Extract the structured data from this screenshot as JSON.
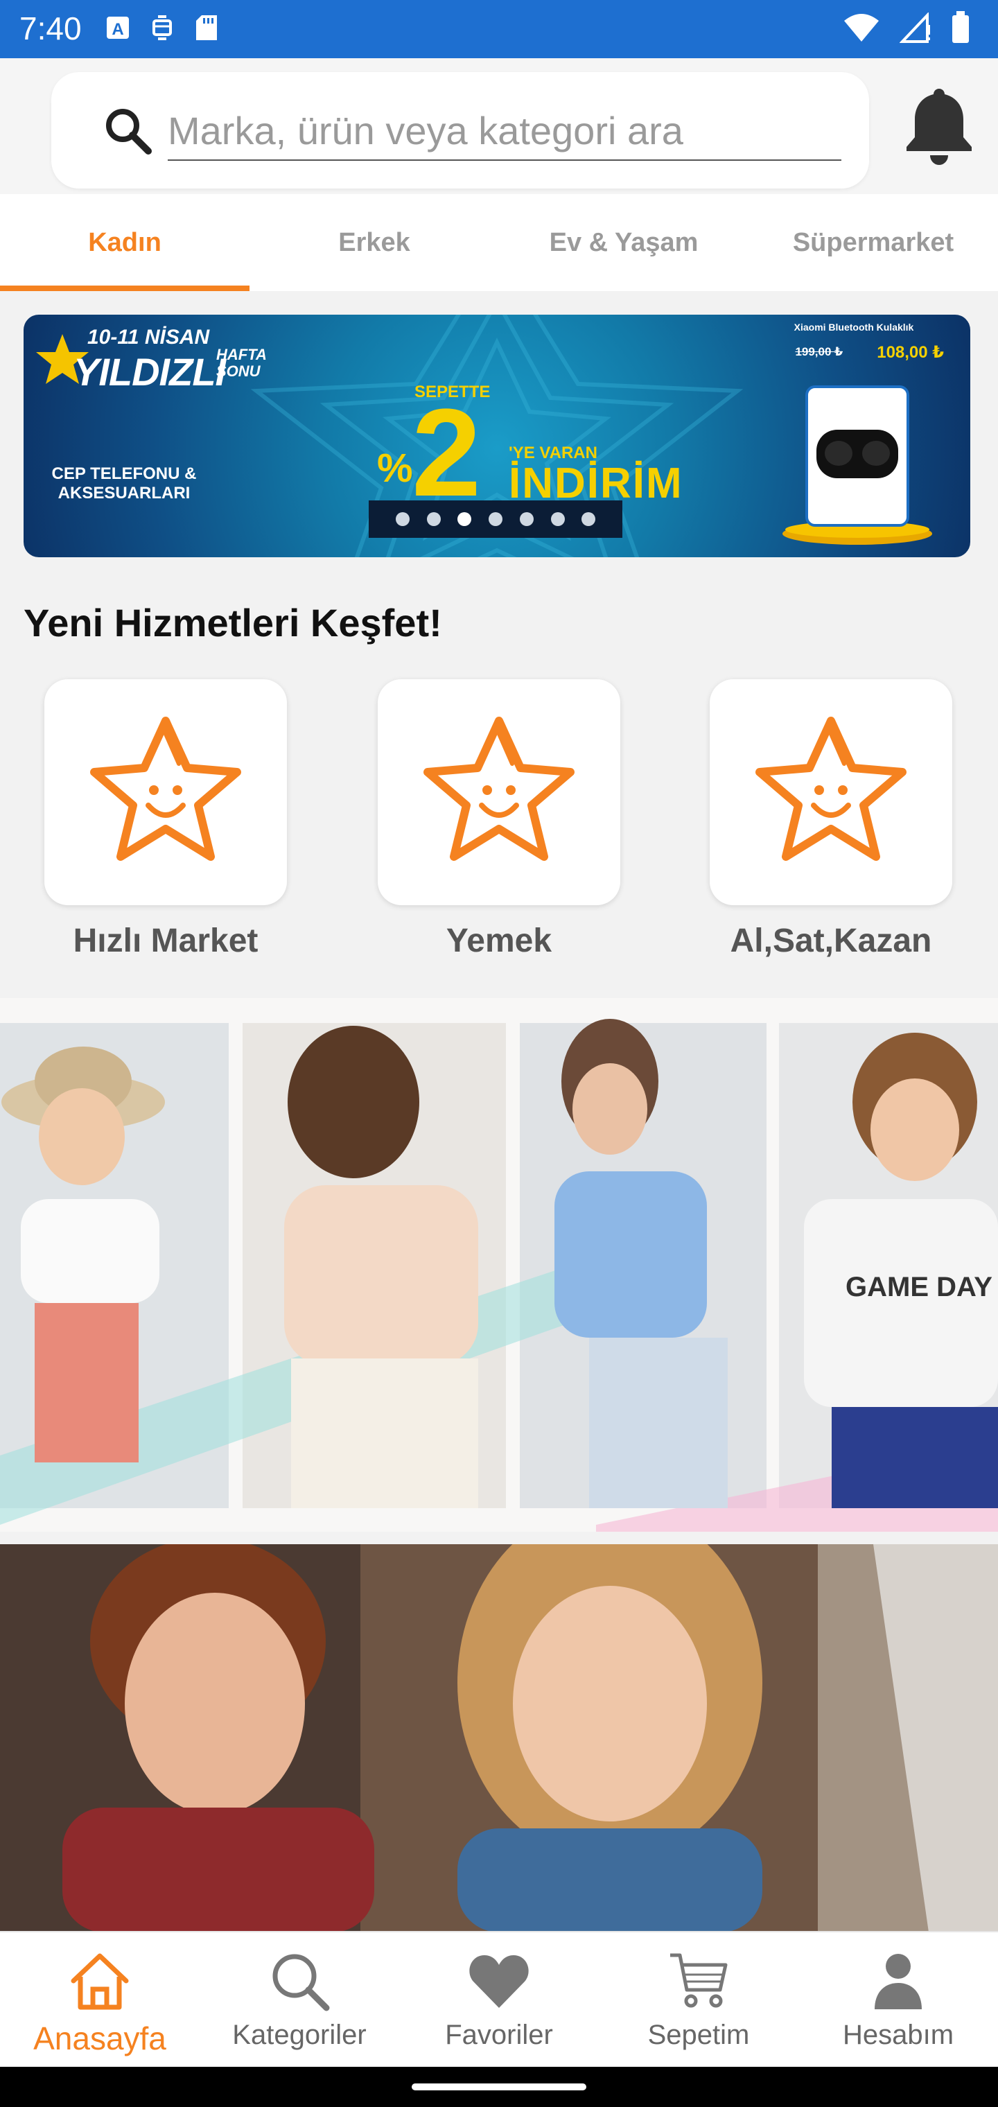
{
  "status_bar": {
    "time": "7:40",
    "background": "#1e6fd0",
    "left_icons": [
      "text-notification-icon",
      "sync-notification-icon",
      "sd-card-icon"
    ],
    "right_icons": [
      "wifi-icon",
      "signal-icon",
      "battery-icon"
    ]
  },
  "search": {
    "placeholder": "Marka, ürün veya kategori ara"
  },
  "tabs": [
    {
      "label": "Kadın",
      "active": true
    },
    {
      "label": "Erkek",
      "active": false
    },
    {
      "label": "Ev & Yaşam",
      "active": false
    },
    {
      "label": "Süpermarket",
      "active": false
    }
  ],
  "banner": {
    "date": "10-11 NİSAN",
    "title": "YILDIZLI",
    "subtitle": "HAFTA SONU",
    "category": "CEP TELEFONU & AKSESUARLARI",
    "sepette": "SEPETTE",
    "percent": "%",
    "discount": "2",
    "ye_varan": "'YE VARAN",
    "indirim": "İNDİRİM",
    "product_name": "Xiaomi Bluetooth Kulaklık",
    "old_price": "199,00 ₺",
    "new_price": "108,00 ₺",
    "slide_count": 7,
    "active_slide": 2
  },
  "services": {
    "title": "Yeni Hizmetleri Keşfet!",
    "items": [
      {
        "label": "Hızlı Market",
        "icon": "smiling-star-icon"
      },
      {
        "label": "Yemek",
        "icon": "smiling-star-icon"
      },
      {
        "label": "Al,Sat,Kazan",
        "icon": "smiling-star-icon"
      }
    ]
  },
  "bottom_nav": [
    {
      "label": "Anasayfa",
      "icon": "home-icon",
      "active": true
    },
    {
      "label": "Kategoriler",
      "icon": "search-icon",
      "active": false
    },
    {
      "label": "Favoriler",
      "icon": "heart-icon",
      "active": false
    },
    {
      "label": "Sepetim",
      "icon": "cart-icon",
      "active": false
    },
    {
      "label": "Hesabım",
      "icon": "user-icon",
      "active": false
    }
  ],
  "colors": {
    "accent": "#f58220",
    "status_bar": "#1e6fd0",
    "banner_yellow": "#f5d000"
  }
}
